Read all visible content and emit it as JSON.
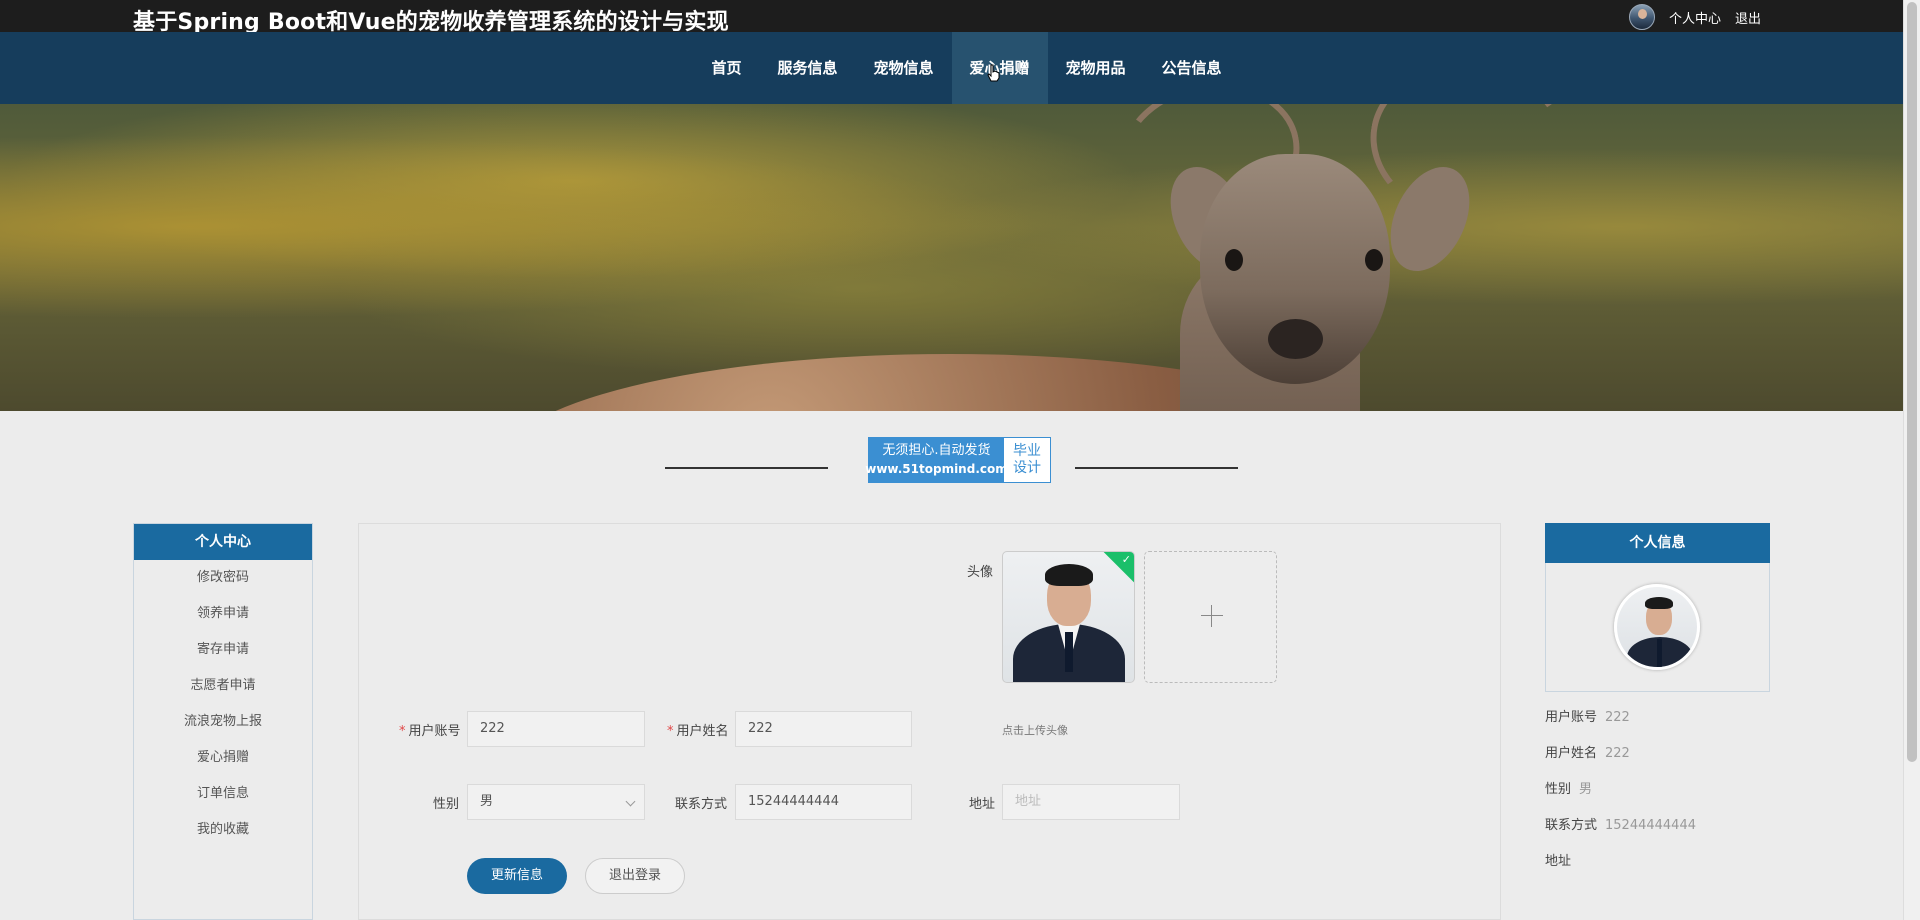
{
  "header": {
    "site_title": "基于Spring Boot和Vue的宠物收养管理系统的设计与实现",
    "user_center": "个人中心",
    "logout": "退出"
  },
  "nav": {
    "items": [
      {
        "label": "首页"
      },
      {
        "label": "服务信息"
      },
      {
        "label": "宠物信息"
      },
      {
        "label": "爱心捐赠"
      },
      {
        "label": "宠物用品"
      },
      {
        "label": "公告信息"
      }
    ],
    "active_index": 3
  },
  "banner": {
    "slide_count": 3,
    "active_slide": 3
  },
  "section_logo": {
    "line1": "无须担心.自动发货",
    "line2": "www.51topmind.com",
    "right_line1": "毕业",
    "right_line2": "设计"
  },
  "sidebar": {
    "title": "个人中心",
    "items": [
      {
        "label": "修改密码"
      },
      {
        "label": "领养申请"
      },
      {
        "label": "寄存申请"
      },
      {
        "label": "志愿者申请"
      },
      {
        "label": "流浪宠物上报"
      },
      {
        "label": "爱心捐赠"
      },
      {
        "label": "订单信息"
      },
      {
        "label": "我的收藏"
      }
    ]
  },
  "form": {
    "avatar_label": "头像",
    "upload_tip": "点击上传头像",
    "account_label": "用户账号",
    "account_value": "222",
    "name_label": "用户姓名",
    "name_value": "222",
    "gender_label": "性别",
    "gender_value": "男",
    "phone_label": "联系方式",
    "phone_value": "15244444444",
    "address_label": "地址",
    "address_placeholder": "地址",
    "update_button": "更新信息",
    "logout_button": "退出登录"
  },
  "profile": {
    "title": "个人信息",
    "rows": [
      {
        "label": "用户账号",
        "value": "222"
      },
      {
        "label": "用户姓名",
        "value": "222"
      },
      {
        "label": "性别",
        "value": "男"
      },
      {
        "label": "联系方式",
        "value": "15244444444"
      },
      {
        "label": "地址",
        "value": ""
      }
    ]
  },
  "colors": {
    "topbar": "#1d1d1d",
    "navbar": "#163d5c",
    "accent": "#1a6aa0",
    "required": "#e04545"
  }
}
